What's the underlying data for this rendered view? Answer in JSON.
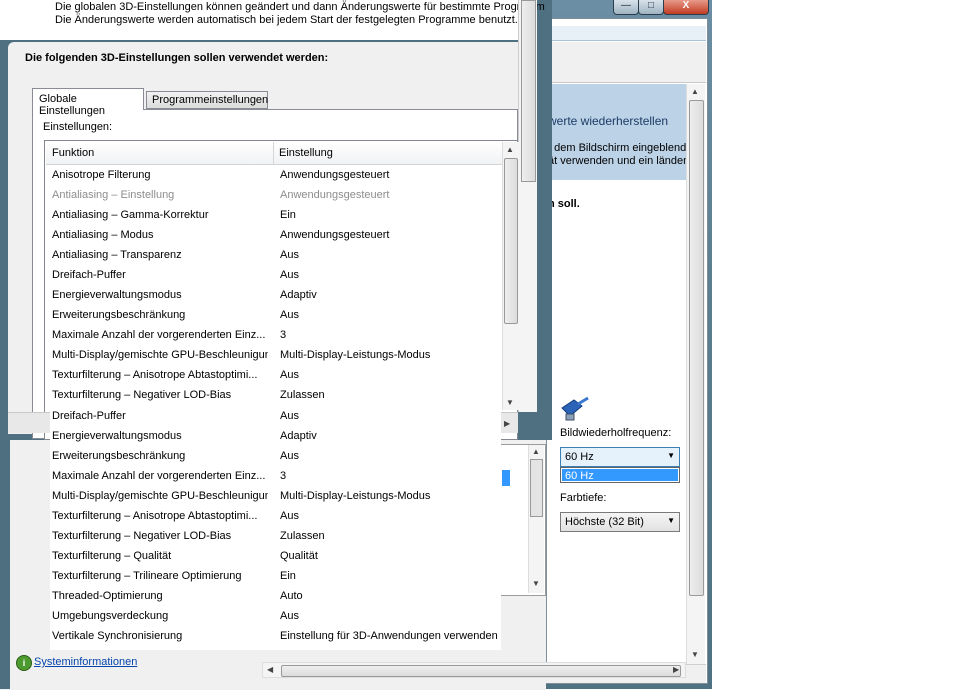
{
  "front_dialog": {
    "description_line1": "Die globalen 3D-Einstellungen können geändert und dann Änderungswerte für bestimmte Programm",
    "description_line2": "Die Änderungswerte werden automatisch bei jedem Start der festgelegten Programme benutzt.",
    "heading": "Die folgenden 3D-Einstellungen sollen verwendet werden:",
    "tabs": [
      {
        "label": "Globale Einstellungen",
        "active": true
      },
      {
        "label": "Programmeinstellungen",
        "active": false
      }
    ],
    "settings_label": "Einstellungen:",
    "columns": [
      "Funktion",
      "Einstellung"
    ],
    "rows": [
      {
        "function": "Anisotrope Filterung",
        "setting": "Anwendungsgesteuert",
        "disabled": false
      },
      {
        "function": "Antialiasing – Einstellung",
        "setting": "Anwendungsgesteuert",
        "disabled": true
      },
      {
        "function": "Antialiasing – Gamma-Korrektur",
        "setting": "Ein",
        "disabled": false
      },
      {
        "function": "Antialiasing – Modus",
        "setting": "Anwendungsgesteuert",
        "disabled": false
      },
      {
        "function": "Antialiasing – Transparenz",
        "setting": "Aus",
        "disabled": false
      },
      {
        "function": "Dreifach-Puffer",
        "setting": "Aus",
        "disabled": false
      },
      {
        "function": "Energieverwaltungsmodus",
        "setting": "Adaptiv",
        "disabled": false
      },
      {
        "function": "Erweiterungsbeschränkung",
        "setting": "Aus",
        "disabled": false
      },
      {
        "function": "Maximale Anzahl der vorgerenderten Einz...",
        "setting": "3",
        "disabled": false
      },
      {
        "function": "Multi-Display/gemischte GPU-Beschleunigung",
        "setting": "Multi-Display-Leistungs-Modus",
        "disabled": false
      },
      {
        "function": "Texturfilterung – Anisotrope Abtastoptimi...",
        "setting": "Aus",
        "disabled": false
      },
      {
        "function": "Texturfilterung – Negativer LOD-Bias",
        "setting": "Zulassen",
        "disabled": false
      },
      {
        "function": "Dreifach-Puffer",
        "setting": "Aus",
        "disabled": false
      },
      {
        "function": "Energieverwaltungsmodus",
        "setting": "Adaptiv",
        "disabled": false
      },
      {
        "function": "Erweiterungsbeschränkung",
        "setting": "Aus",
        "disabled": false
      },
      {
        "function": "Maximale Anzahl der vorgerenderten Einz...",
        "setting": "3",
        "disabled": false
      },
      {
        "function": "Multi-Display/gemischte GPU-Beschleunigung",
        "setting": "Multi-Display-Leistungs-Modus",
        "disabled": false
      },
      {
        "function": "Texturfilterung – Anisotrope Abtastoptimi...",
        "setting": "Aus",
        "disabled": false
      },
      {
        "function": "Texturfilterung – Negativer LOD-Bias",
        "setting": "Zulassen",
        "disabled": false
      },
      {
        "function": "Texturfilterung – Qualität",
        "setting": "Qualität",
        "disabled": false
      },
      {
        "function": "Texturfilterung – Trilineare Optimierung",
        "setting": "Ein",
        "disabled": false
      },
      {
        "function": "Threaded-Optimierung",
        "setting": "Auto",
        "disabled": false
      },
      {
        "function": "Umgebungsverdeckung",
        "setting": "Aus",
        "disabled": false
      },
      {
        "function": "Vertikale Synchronisierung",
        "setting": "Einstellung für 3D-Anwendungen verwenden",
        "disabled": false
      }
    ]
  },
  "back_window": {
    "banner_title": "werte wiederherstellen",
    "banner_line1": "f dem Bildschirm eingeblende",
    "banner_line2": "ät verwenden und ein länden",
    "question": "n soll.",
    "refresh_label": "Bildwiederholfrequenz:",
    "refresh_value": "60 Hz",
    "refresh_option": "60 Hz",
    "color_label": "Farbtiefe:",
    "color_value": "Höchste (32 Bit)",
    "window_controls": {
      "minimize": "—",
      "maximize": "□",
      "close": "X"
    }
  },
  "footer": {
    "system_info_link": "Systeminformationen"
  },
  "icons": [
    "monitor-cable-icon",
    "info-icon",
    "scroll-up-arrow-icon",
    "scroll-down-arrow-icon",
    "chevron-down-icon"
  ]
}
